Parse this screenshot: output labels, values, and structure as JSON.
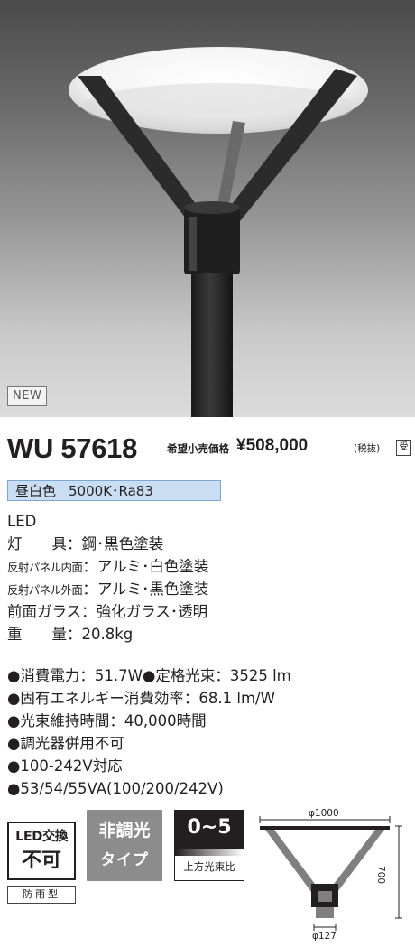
{
  "badge_new": "NEW",
  "product": {
    "model": "WU 57618",
    "price_label": "希望小売価格",
    "price": "¥508,000",
    "tax_note": "(税抜)",
    "order_mark": "受"
  },
  "color": {
    "name": "昼白色",
    "temp_cri": "5000K･Ra83"
  },
  "light_source": "LED",
  "specs": [
    {
      "label": "灯　　具",
      "value": "：鋼･黒色塗装",
      "small": false
    },
    {
      "label": "反射パネル内面",
      "value": "：アルミ･白色塗装",
      "small": true
    },
    {
      "label": "反射パネル外面",
      "value": "：アルミ･黒色塗装",
      "small": true
    },
    {
      "label": "前面ガラス",
      "value": "：強化ガラス･透明",
      "small": false
    },
    {
      "label": "重　　量",
      "value": "：20.8kg",
      "small": false
    }
  ],
  "bullets": [
    "●消費電力：51.7W●定格光束：3525 lm",
    "●固有エネルギー消費効率：68.1 lm/W",
    "●光束維持時間：40,000時間",
    "●調光器併用不可",
    "●100-242V対応",
    "●53/54/55VA(100/200/242V)"
  ],
  "badges": {
    "led_line1": "LED交換",
    "led_line2": "不可",
    "weather": "防雨型",
    "dimming_line1": "非調光",
    "dimming_line2": "タイプ",
    "ratio_value": "0~5",
    "ratio_caption": "上方光束比"
  },
  "dimensions": {
    "width": "φ1000",
    "height": "700",
    "pole": "φ127"
  }
}
